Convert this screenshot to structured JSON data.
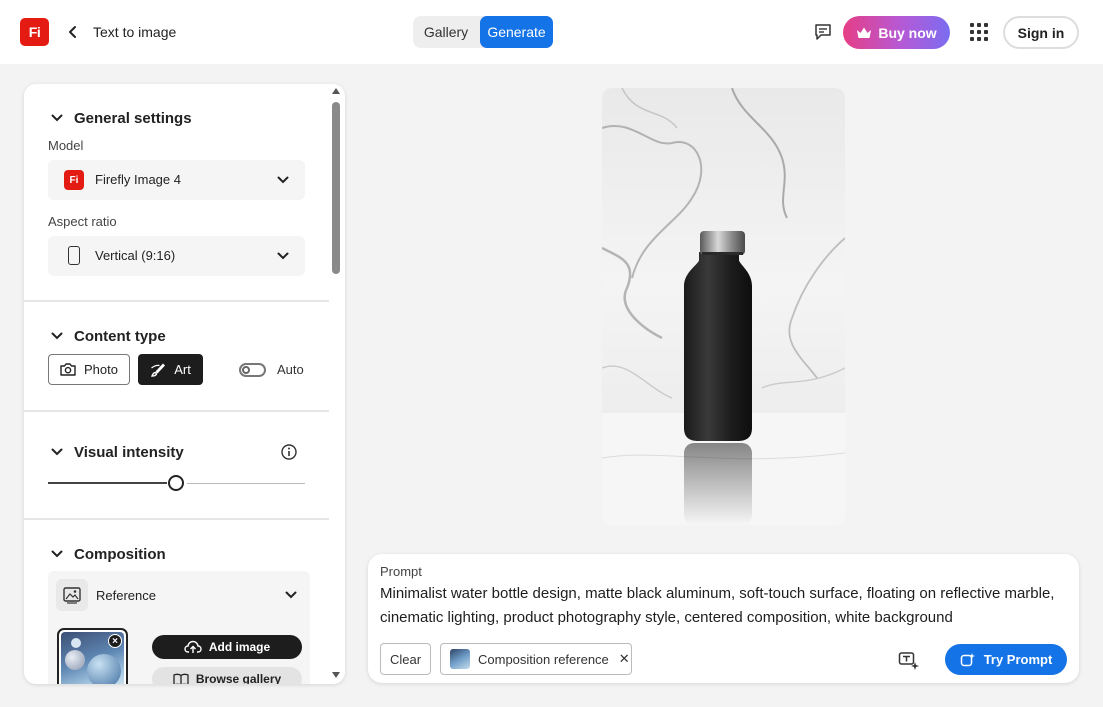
{
  "header": {
    "logo_text": "Fi",
    "title": "Text to image",
    "tabs": [
      {
        "label": "Gallery",
        "active": false
      },
      {
        "label": "Generate",
        "active": true
      }
    ],
    "buy_label": "Buy now",
    "signin_label": "Sign in"
  },
  "sidebar": {
    "general": {
      "title": "General settings",
      "model_label": "Model",
      "model_value": "Firefly Image 4",
      "model_icon_text": "Fi",
      "aspect_label": "Aspect ratio",
      "aspect_value": "Vertical (9:16)"
    },
    "content_type": {
      "title": "Content type",
      "photo_label": "Photo",
      "art_label": "Art",
      "selected": "Art",
      "auto_label": "Auto",
      "auto_on": false
    },
    "visual_intensity": {
      "title": "Visual intensity",
      "value_fraction": 0.5
    },
    "composition": {
      "title": "Composition",
      "reference_label": "Reference",
      "add_image_label": "Add image",
      "browse_label": "Browse gallery"
    }
  },
  "prompt": {
    "label": "Prompt",
    "text": "Minimalist water bottle design, matte black aluminum, soft-touch surface, floating on reflective marble, cinematic lighting, product photography style, centered composition, white background",
    "clear_label": "Clear",
    "chip_label": "Composition reference",
    "try_label": "Try Prompt"
  },
  "colors": {
    "accent": "#1473e6",
    "brand": "#e31b13",
    "buy_gradient_start": "#e63e86",
    "buy_gradient_end": "#7b6cf0"
  },
  "icons": [
    "back-chevron-icon",
    "feedback-icon",
    "crown-icon",
    "apps-grid-icon",
    "chevron-down-icon",
    "phone-outline-icon",
    "camera-icon",
    "art-brush-icon",
    "info-icon",
    "reference-image-icon",
    "upload-cloud-icon",
    "browse-book-icon",
    "text-effects-icon",
    "sparkle-icon"
  ]
}
